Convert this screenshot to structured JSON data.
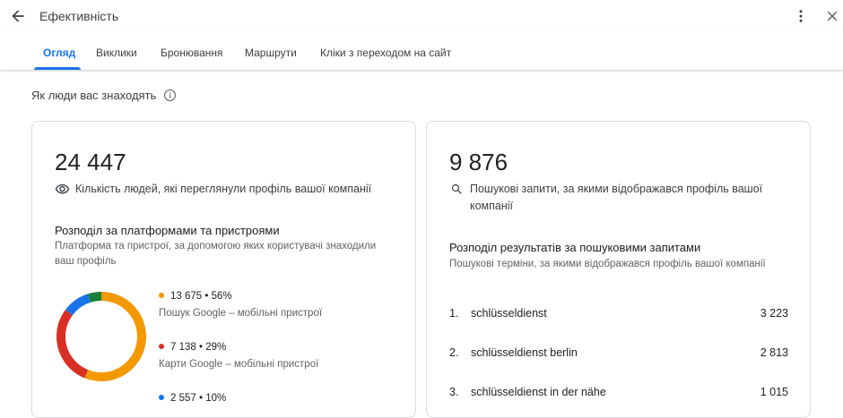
{
  "header": {
    "title": "Ефективність"
  },
  "tabs": [
    {
      "label": "Огляд",
      "active": true
    },
    {
      "label": "Виклики"
    },
    {
      "label": "Бронювання"
    },
    {
      "label": "Маршрути"
    },
    {
      "label": "Кліки з переходом на сайт"
    }
  ],
  "section": {
    "title": "Як люди вас знаходять"
  },
  "profile_views": {
    "value": "24 447",
    "label": "Кількість людей, які переглянули профіль вашої компанії",
    "breakdown_title": "Розподіл за платформами та пристроями",
    "breakdown_desc": "Платформа та пристрої, за допомогою яких користувачі знаходили ваш профіль",
    "legend": [
      {
        "value": "13 675 • 56%",
        "label": "Пошук Google – мобільні пристрої",
        "color": "#f29900"
      },
      {
        "value": "7 138 • 29%",
        "label": "Карти Google – мобільні пристрої",
        "color": "#d93025"
      },
      {
        "value": "2 557 • 10%",
        "label": "",
        "color": "#1a73e8"
      }
    ],
    "chart_data": {
      "type": "pie",
      "series": [
        {
          "value": 56,
          "color": "#f29900"
        },
        {
          "value": 29,
          "color": "#d93025"
        },
        {
          "value": 10,
          "color": "#1a73e8"
        },
        {
          "value": 5,
          "color": "#188038"
        }
      ]
    }
  },
  "searches": {
    "value": "9 876",
    "label": "Пошукові запити, за якими відображався профіль вашої компанії",
    "breakdown_title": "Розподіл результатів за пошуковими запитами",
    "breakdown_desc": "Пошукові терміни, за якими відображався профіль вашої компанії",
    "rows": [
      {
        "num": "1.",
        "query": "schlüsseldienst",
        "count": "3 223"
      },
      {
        "num": "2.",
        "query": "schlüsseldienst berlin",
        "count": "2 813"
      },
      {
        "num": "3.",
        "query": "schlüsseldienst in der nähe",
        "count": "1 015"
      }
    ]
  }
}
